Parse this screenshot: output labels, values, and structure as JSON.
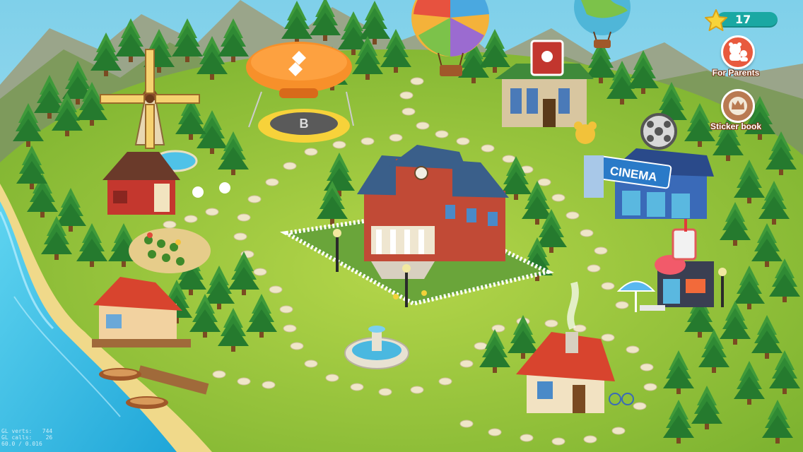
{
  "hud": {
    "star_count": "17",
    "for_parents_label": "For Parents",
    "sticker_book_label": "Sticker book"
  },
  "map": {
    "blimp_letter": "B",
    "cinema_sign": "CINEMA"
  },
  "debug": {
    "line1": "GL verts:   744",
    "line2": "GL calls:    26",
    "line3": "60.0 / 0.016"
  },
  "colors": {
    "sky": "#8fd3e8",
    "grass": "#8ec23a",
    "path": "#efe6c8",
    "water": "#3cc2e8",
    "accent_teal": "#1aa8a3",
    "parents_button": "#e85a3e",
    "sticker_button": "#b97a52"
  },
  "icons": {
    "star": "star-icon",
    "parents": "parents-icon",
    "sticker": "crown-icon"
  }
}
